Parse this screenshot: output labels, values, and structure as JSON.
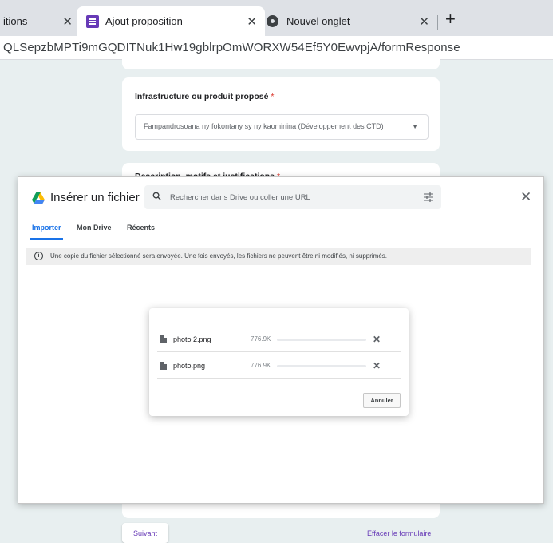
{
  "browser": {
    "tabs": [
      {
        "label": "itions"
      },
      {
        "label": "Ajout proposition"
      },
      {
        "label": "Nouvel onglet"
      }
    ],
    "url": "QLSepzbMPTi9mGQDITNuk1Hw19gblrpOmWORXW54Ef5Y0EwvpjA/formResponse"
  },
  "form": {
    "infra_question": "Infrastructure ou produit proposé",
    "required_mark": "*",
    "infra_value": "Fampandrosoana ny fokontany sy ny kaominina (Développement des CTD)",
    "desc_question": "Description, motifs et justifications",
    "next_button": "Suivant",
    "clear_link": "Effacer le formulaire"
  },
  "picker": {
    "title": "Insérer un fichier",
    "search_placeholder": "Rechercher dans Drive ou coller une URL",
    "tabs": [
      "Importer",
      "Mon Drive",
      "Récents"
    ],
    "active_tab": "Importer",
    "info_text": "Une copie du fichier sélectionné sera envoyée. Une fois envoyés, les fichiers ne peuvent être ni modifiés, ni supprimés.",
    "info_icon": "i",
    "accent": "#1a73e8"
  },
  "upload": {
    "files": [
      {
        "name": "photo 2.png",
        "size": "776.9K",
        "progress": 0
      },
      {
        "name": "photo.png",
        "size": "776.9K",
        "progress": 0
      }
    ],
    "cancel_button": "Annuler"
  }
}
